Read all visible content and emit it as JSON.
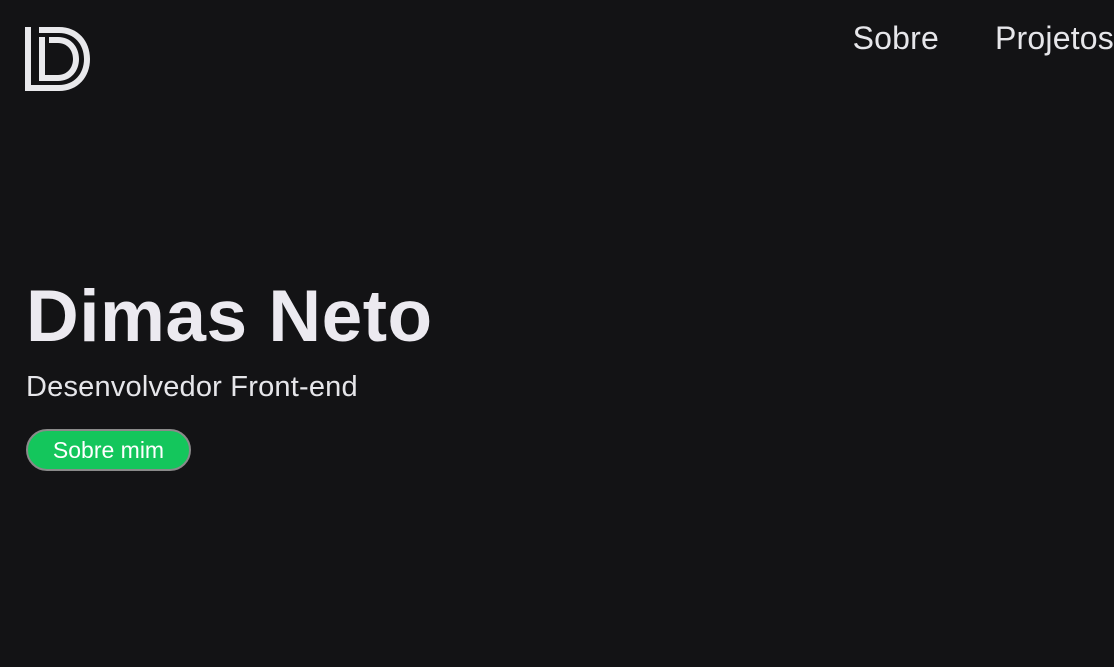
{
  "brand": {
    "logo_icon": "dd-monogram-logo"
  },
  "nav": {
    "items": [
      {
        "label": "Sobre"
      },
      {
        "label": "Projetos"
      }
    ]
  },
  "hero": {
    "name": "Dimas Neto",
    "role": "Desenvolvedor Front-end",
    "cta_label": "Sobre mim"
  },
  "colors": {
    "background": "#131315",
    "text": "#e9e9ec",
    "accent": "#14c65c"
  }
}
